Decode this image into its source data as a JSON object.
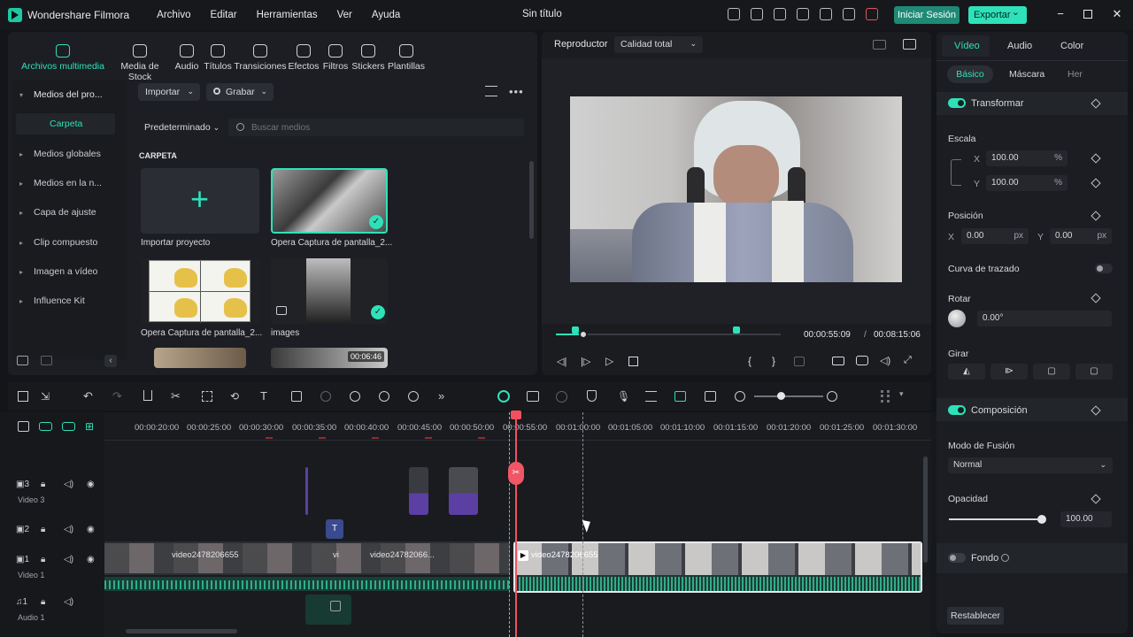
{
  "title_bar": {
    "app_name": "Wondershare Filmora",
    "menu": [
      "Archivo",
      "Editar",
      "Herramientas",
      "Ver",
      "Ayuda"
    ],
    "document_title": "Sin título",
    "login_label": "Iniciar Sesión",
    "export_label": "Exportar"
  },
  "media_tabs": [
    {
      "label": "Archivos multimedia",
      "icon": "folder-media-icon"
    },
    {
      "label": "Media de Stock",
      "icon": "stock-icon"
    },
    {
      "label": "Audio",
      "icon": "music-note-icon"
    },
    {
      "label": "Títulos",
      "icon": "text-t-icon"
    },
    {
      "label": "Transiciones",
      "icon": "transition-icon"
    },
    {
      "label": "Efectos",
      "icon": "effects-icon"
    },
    {
      "label": "Filtros",
      "icon": "filter-icon"
    },
    {
      "label": "Stickers",
      "icon": "sticker-icon"
    },
    {
      "label": "Plantillas",
      "icon": "template-icon"
    }
  ],
  "media_sidebar": {
    "project_media": "Medios del pro...",
    "folder": "Carpeta",
    "items": [
      "Medios globales",
      "Medios en la n...",
      "Capa de ajuste",
      "Clip compuesto",
      "Imagen a vídeo",
      "Influence Kit"
    ]
  },
  "media_toolbar": {
    "import_label": "Importar",
    "record_label": "Grabar",
    "sort_label": "Predeterminado",
    "search_placeholder": "Buscar medios",
    "section_title": "CARPETA"
  },
  "media_items": [
    {
      "label": "Importar proyecto"
    },
    {
      "label": "Opera Captura de pantalla_2..."
    },
    {
      "label": "Opera Captura de pantalla_2..."
    },
    {
      "label": "images"
    },
    {
      "label": ""
    },
    {
      "label": "",
      "duration": "00:06:46"
    }
  ],
  "player": {
    "label": "Reproductor",
    "quality": "Calidad total",
    "current_time": "00:00:55:09",
    "separator": "/",
    "total_time": "00:08:15:06",
    "progress": 0.04
  },
  "properties": {
    "tabs": [
      "Vídeo",
      "Audio",
      "Color"
    ],
    "subtabs": [
      "Básico",
      "Máscara",
      "Her"
    ],
    "transform_label": "Transformar",
    "scale_label": "Escala",
    "scale_x": "100.00",
    "scale_y": "100.00",
    "percent_unit": "%",
    "position_label": "Posición",
    "pos_x": "0.00",
    "pos_y": "0.00",
    "px_unit": "px",
    "axis_x": "X",
    "axis_y": "Y",
    "path_curve_label": "Curva de trazado",
    "rotate_label": "Rotar",
    "rotate_value": "0.00°",
    "flip_label": "Girar",
    "composition_label": "Composición",
    "blend_mode_label": "Modo de Fusión",
    "blend_mode_value": "Normal",
    "opacity_label": "Opacidad",
    "opacity_value": "100.00",
    "opacity_level": 1.0,
    "background_label": "Fondo",
    "reset_label": "Restablecer"
  },
  "timeline": {
    "ruler": [
      "00:00:20:00",
      "00:00:25:00",
      "00:00:30:00",
      "00:00:35:00",
      "00:00:40:00",
      "00:00:45:00",
      "00:00:50:00",
      "00:00:55:00",
      "00:01:00:00",
      "00:01:05:00",
      "00:01:10:00",
      "00:01:15:00",
      "00:01:20:00",
      "00:01:25:00",
      "00:01:30:00"
    ],
    "tracks": [
      {
        "number": "3",
        "name": "Video 3"
      },
      {
        "number": "2",
        "name": ""
      },
      {
        "number": "1",
        "name": "Video 1"
      },
      {
        "number": "1",
        "name": "Audio 1"
      }
    ],
    "clip_name": "video2478206655",
    "clip_name_short_a": "vi",
    "clip_name_short_b": "video2478206655",
    "clip_name_short_c": "video24782066..."
  }
}
